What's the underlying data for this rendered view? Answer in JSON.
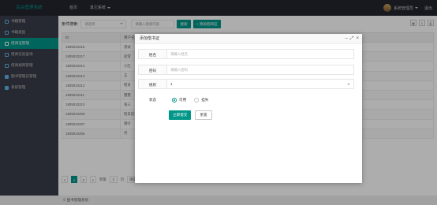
{
  "header": {
    "brand": "后台管理系统",
    "nav": [
      {
        "label": "首页"
      },
      {
        "label": "其它系统"
      }
    ],
    "user_name": "系统管理员",
    "logout_label": "退出"
  },
  "sidebar": {
    "items": [
      {
        "label": "书籍管理",
        "icon": "book-icon"
      },
      {
        "label": "书籍类型",
        "icon": "tag-icon"
      },
      {
        "label": "借阅证管理",
        "icon": "card-icon"
      },
      {
        "label": "借阅信息查询",
        "icon": "search-icon"
      },
      {
        "label": "借阅规则管理",
        "icon": "rule-icon"
      },
      {
        "label": "图书管理员管理",
        "icon": "users-icon"
      },
      {
        "label": "系统管理",
        "icon": "settings-icon"
      }
    ],
    "active_index": 2
  },
  "toolbar": {
    "filter_label": "条件搜索:",
    "select_placeholder": "请选择",
    "keyword_placeholder": "请输入搜索内容",
    "search_label": "搜索",
    "add_label": "+ 添加借阅证"
  },
  "table": {
    "columns": [
      "ID",
      "用户名"
    ],
    "rows": [
      [
        "1805010216",
        "测试"
      ],
      [
        "1805010217",
        "赵雪"
      ],
      [
        "1805010214",
        "小红"
      ],
      [
        "1805010213",
        "王"
      ],
      [
        "1805010212",
        "昭日"
      ],
      [
        "1805010211",
        "慧慧"
      ],
      [
        "1805010210",
        "张三"
      ],
      [
        "1805010209",
        "昭日前日"
      ],
      [
        "1805010207",
        "钢仔"
      ],
      [
        "1805010206",
        "月"
      ]
    ]
  },
  "pager": {
    "prev": "<",
    "pages": [
      "1",
      "2"
    ],
    "current": "1",
    "next": ">",
    "goto_label": "到第",
    "goto_value": "1",
    "page_unit": "页",
    "go_label": "确定",
    "total": "共 14 条",
    "per_page": "10 条/页"
  },
  "footer": {
    "text": "© 图书管理系统"
  },
  "dialog": {
    "title": "添加借书证",
    "controls": [
      "–",
      "⤢",
      "×"
    ],
    "fields": {
      "name_label": "姓名",
      "name_placeholder": "请输入姓名",
      "password_label": "密码",
      "password_placeholder": "请输入密码",
      "rule_label": "规则",
      "rule_value": "1",
      "status_label": "状态",
      "status_options": [
        "可用",
        "挂失"
      ],
      "status_selected": "可用"
    },
    "submit_label": "立即提交",
    "reset_label": "重置"
  },
  "colors": {
    "accent": "#009688",
    "header_bg": "#23262e",
    "sidebar_bg": "#393d49"
  }
}
